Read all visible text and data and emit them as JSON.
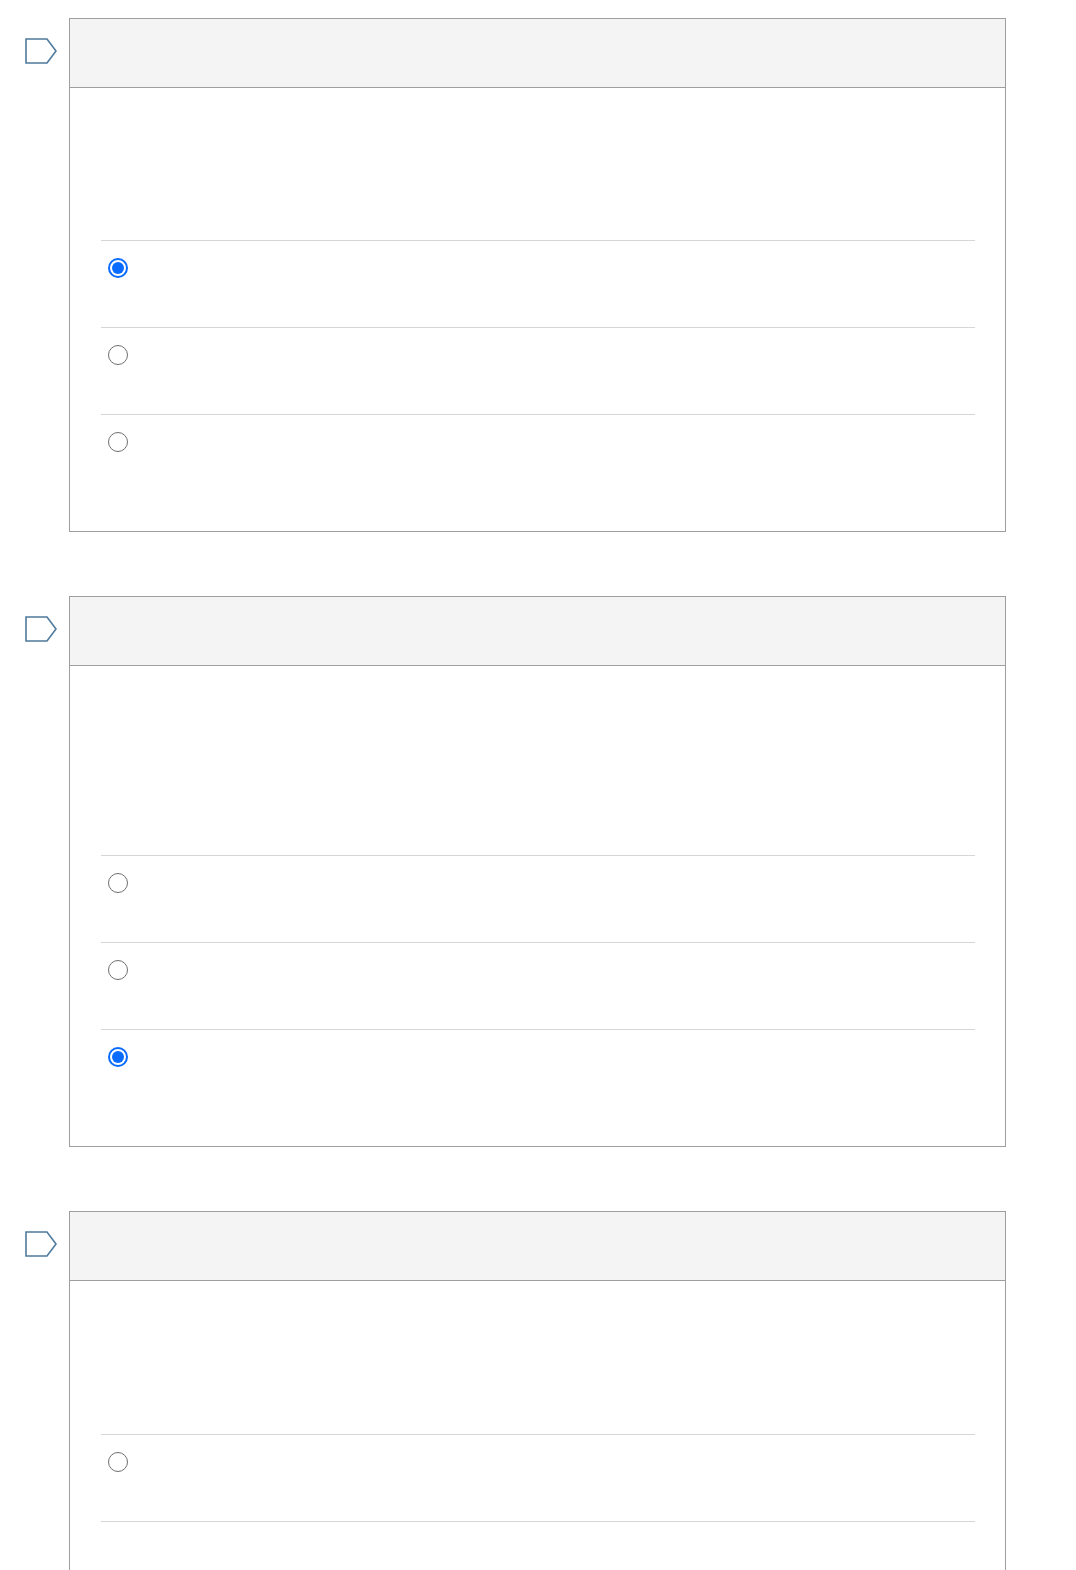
{
  "questions": [
    {
      "flagged": false,
      "cut_off": false,
      "options": [
        {
          "selected": true
        },
        {
          "selected": false
        },
        {
          "selected": false
        }
      ]
    },
    {
      "flagged": false,
      "cut_off": false,
      "options": [
        {
          "selected": false
        },
        {
          "selected": false
        },
        {
          "selected": true
        }
      ]
    },
    {
      "flagged": false,
      "cut_off": true,
      "options": [
        {
          "selected": false
        }
      ]
    }
  ]
}
